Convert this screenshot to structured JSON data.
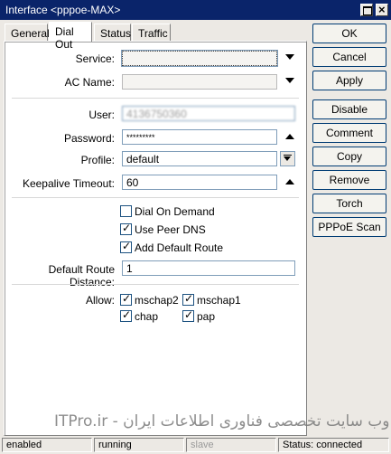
{
  "window": {
    "title": "Interface <pppoe-MAX>"
  },
  "tabs": [
    {
      "label": "General"
    },
    {
      "label": "Dial Out"
    },
    {
      "label": "Status"
    },
    {
      "label": "Traffic"
    }
  ],
  "form": {
    "service": {
      "label": "Service:",
      "value": ""
    },
    "ac_name": {
      "label": "AC Name:",
      "value": ""
    },
    "user": {
      "label": "User:",
      "value": "4136750360"
    },
    "password": {
      "label": "Password:",
      "value": "*********"
    },
    "profile": {
      "label": "Profile:",
      "value": "default"
    },
    "keepalive": {
      "label": "Keepalive Timeout:",
      "value": "60"
    },
    "dial_on_demand": {
      "label": "Dial On Demand",
      "checked": false
    },
    "use_peer_dns": {
      "label": "Use Peer DNS",
      "checked": true
    },
    "add_default_route": {
      "label": "Add Default Route",
      "checked": true
    },
    "default_route_distance": {
      "label": "Default Route Distance:",
      "value": "1"
    },
    "allow": {
      "label": "Allow:",
      "options": [
        {
          "label": "mschap2",
          "checked": true
        },
        {
          "label": "mschap1",
          "checked": true
        },
        {
          "label": "chap",
          "checked": true
        },
        {
          "label": "pap",
          "checked": true
        }
      ]
    }
  },
  "buttons": {
    "ok": "OK",
    "cancel": "Cancel",
    "apply": "Apply",
    "disable": "Disable",
    "comment": "Comment",
    "copy": "Copy",
    "remove": "Remove",
    "torch": "Torch",
    "pppoe_scan": "PPPoE Scan"
  },
  "statusbar": {
    "state": "enabled",
    "running": "running",
    "slave": "slave",
    "status": "Status: connected"
  },
  "watermark": "ITPro.ir - وب سایت تخصصی فناوری اطلاعات ایران"
}
